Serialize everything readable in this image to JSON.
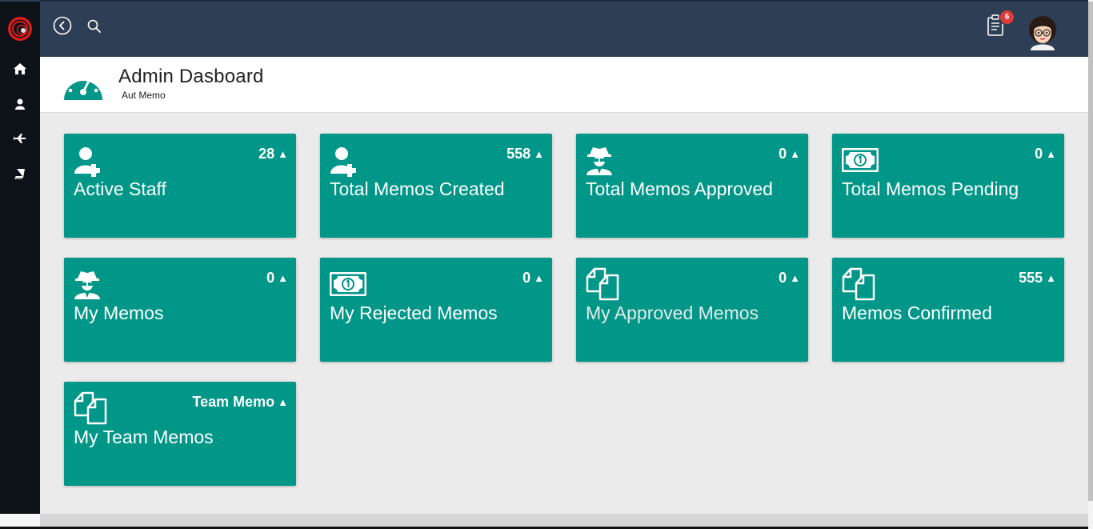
{
  "header": {
    "title": "Admin Dasboard",
    "subtitle": "Aut Memo"
  },
  "topbar": {
    "notification_count": "6"
  },
  "sidebar": {
    "items": [
      {
        "icon": "home-icon"
      },
      {
        "icon": "user-icon"
      },
      {
        "icon": "plane-icon"
      },
      {
        "icon": "book-icon"
      }
    ]
  },
  "colors": {
    "card": "#009688",
    "topbar": "#2e3e54",
    "sidebar": "#0d1118",
    "badge": "#e03a3a"
  },
  "cards": [
    {
      "title": "Active Staff",
      "count": "28",
      "icon": "user-plus-icon"
    },
    {
      "title": "Total Memos Created",
      "count": "558",
      "icon": "user-plus-icon"
    },
    {
      "title": "Total Memos Approved",
      "count": "0",
      "icon": "user-secret-icon"
    },
    {
      "title": "Total Memos Pending",
      "count": "0",
      "icon": "money-bill-icon"
    },
    {
      "title": "My Memos",
      "count": "0",
      "icon": "user-secret-icon"
    },
    {
      "title": "My Rejected Memos",
      "count": "0",
      "icon": "money-bill-icon"
    },
    {
      "title": "My Approved Memos",
      "count": "0",
      "icon": "copy-icon"
    },
    {
      "title": "Memos Confirmed",
      "count": "555",
      "icon": "copy-icon"
    },
    {
      "title": "My Team Memos",
      "count": "Team Memo",
      "icon": "copy-icon"
    }
  ]
}
